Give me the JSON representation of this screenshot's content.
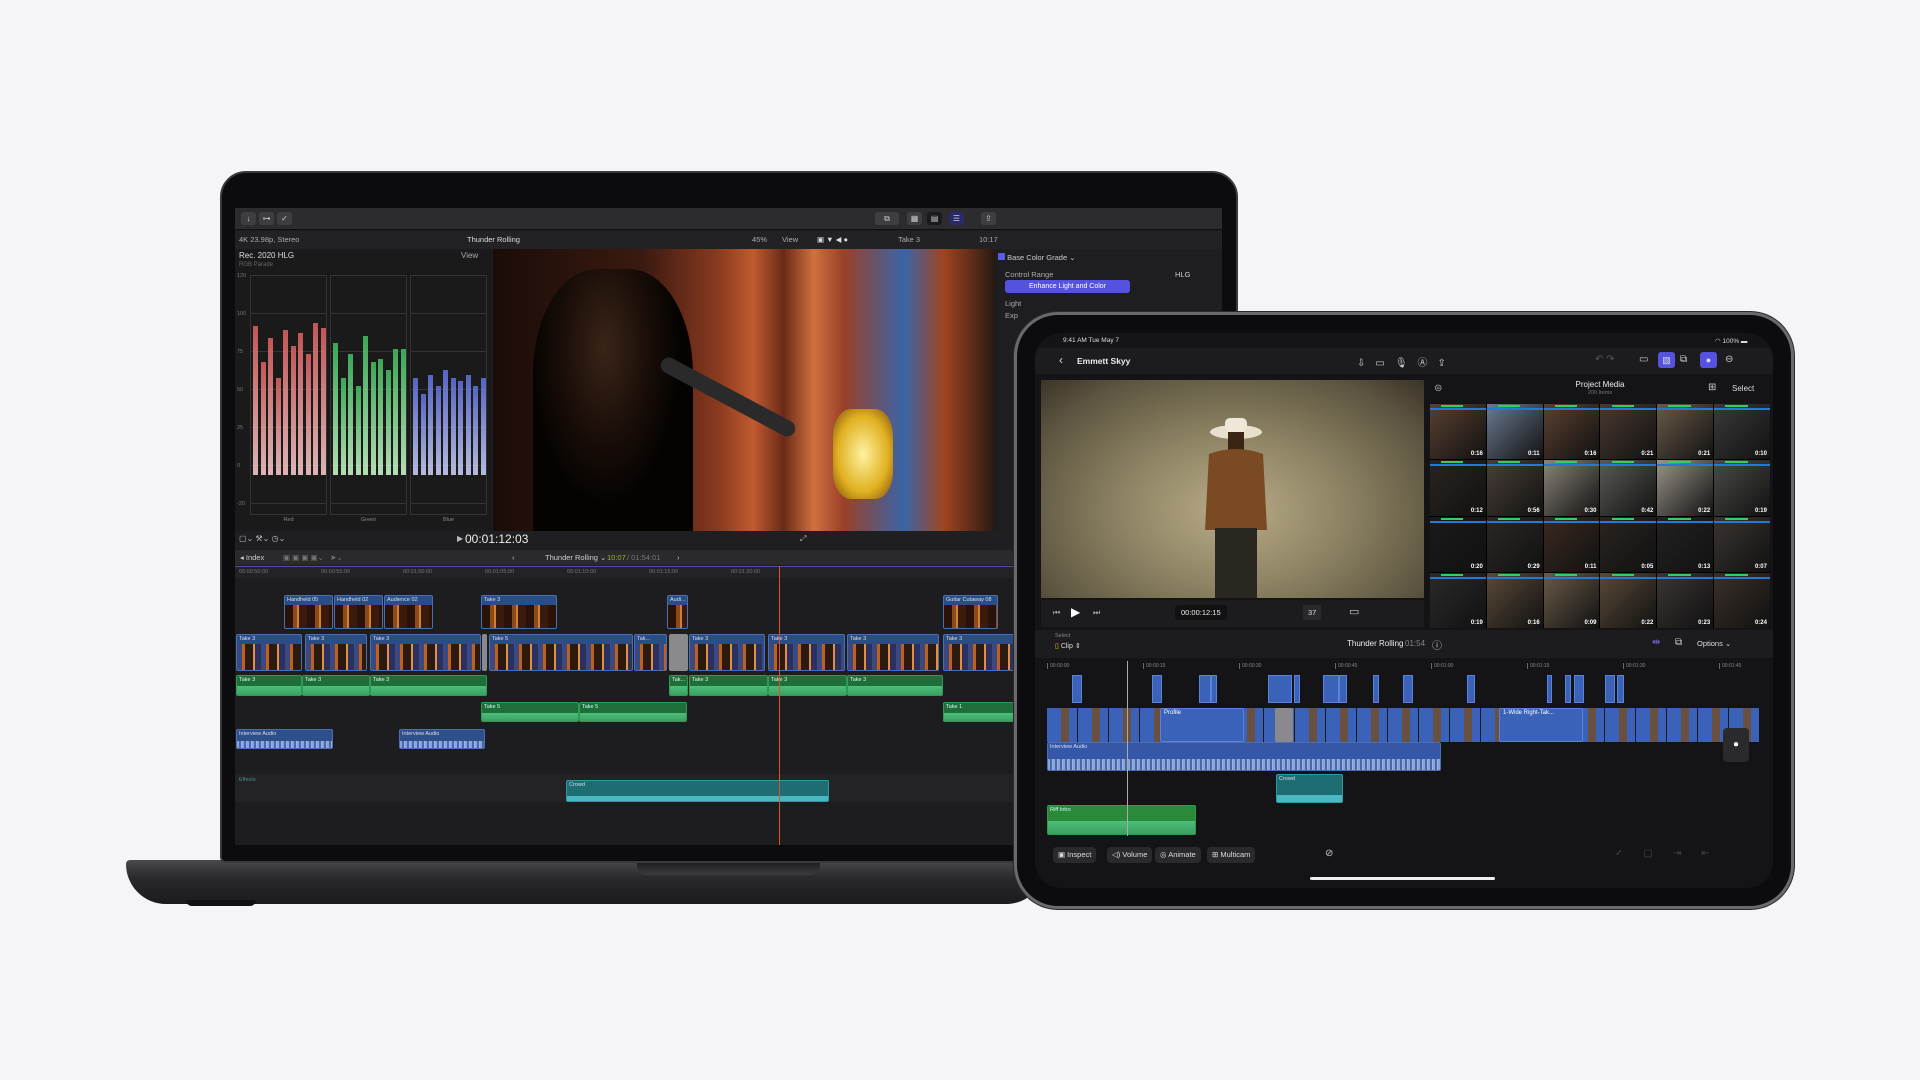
{
  "mac": {
    "toolbar": {
      "icons": [
        "import-icon",
        "keyword-icon",
        "checkmark-icon",
        "share-icon"
      ]
    },
    "info": {
      "format": "4K 23.98p, Stereo",
      "project": "Thunder Rolling",
      "zoom": "45%",
      "view": "View",
      "clip": "Take 3",
      "duration": "10:17"
    },
    "scopes": {
      "color_space": "Rec. 2020 HLG",
      "view": "View",
      "title": "RGB Parade",
      "ticks": [
        "120",
        "100",
        "75",
        "50",
        "25",
        "0",
        "-20"
      ],
      "channels": [
        "Red",
        "Green",
        "Blue"
      ]
    },
    "inspector": {
      "effect": "Base Color Grade",
      "control_range_label": "Control Range",
      "control_range_value": "HLG",
      "enhance_button": "Enhance Light and Color",
      "light_label": "Light",
      "exposure_label": "Exp"
    },
    "viewer": {
      "timecode": "00:01:12:03"
    },
    "timeline": {
      "index": "Index",
      "project": "Thunder Rolling",
      "position": "10:07",
      "total": "/ 01:54:01",
      "ruler": [
        "00:00:50:00",
        "00:00:55:00",
        "00:01:00:00",
        "00:01:05:00",
        "00:01:10:00",
        "00:01:15:00",
        "00:01:20:00"
      ],
      "connected": [
        "Handheld 05",
        "Handheld 02",
        "Audience 02",
        "Take 3",
        "Audi...",
        "Guitar Cutaway 08"
      ],
      "primary": [
        "Take 3",
        "Take 3",
        "Take 3",
        "Take 5",
        "Tak...",
        "Take 3",
        "Take 3",
        "Take 3",
        "Take 3"
      ],
      "audio1": [
        "Take 3",
        "Take 3",
        "Take 3",
        "Tak...",
        "Take 3",
        "Take 3",
        "Take 3"
      ],
      "audio2": [
        "Take 5",
        "Take 5",
        "Take 1"
      ],
      "interview": [
        "Interview Audio",
        "Interview Audio"
      ],
      "effects_lane": "Effects",
      "crowd": "Crowd"
    }
  },
  "ipad": {
    "status": {
      "time": "9:41 AM  Tue May 7",
      "battery": "100%"
    },
    "nav": {
      "title": "Emmett Skyy"
    },
    "browser": {
      "title": "Project Media",
      "count": "200 Items",
      "select": "Select",
      "durations": [
        "0:16",
        "0:11",
        "0:16",
        "0:21",
        "0:21",
        "0:10",
        "0:12",
        "0:56",
        "0:30",
        "0:42",
        "0:22",
        "0:19",
        "0:20",
        "0:29",
        "0:11",
        "0:05",
        "0:13",
        "0:07",
        "0:19",
        "0:16",
        "0:09",
        "0:22",
        "0:23",
        "0:24"
      ]
    },
    "transport": {
      "timecode": "00:00:12:15",
      "zoom": "37"
    },
    "timeline": {
      "select_label": "Select",
      "select_value": "Clip",
      "project": "Thunder Rolling",
      "duration": "01:54",
      "options": "Options",
      "ruler": [
        "00:00:00",
        "00:00:15",
        "00:00:30",
        "00:00:45",
        "00:01:00",
        "00:01:15",
        "00:01:30",
        "00:01:45"
      ],
      "clips": {
        "profile": "Profile",
        "wide": "1-Wide Right-Tak...",
        "interview": "Interview Audio",
        "crowd": "Crowd",
        "riff": "Riff Intro"
      }
    },
    "toolbar": [
      "Inspect",
      "Volume",
      "Animate",
      "Multicam"
    ]
  }
}
